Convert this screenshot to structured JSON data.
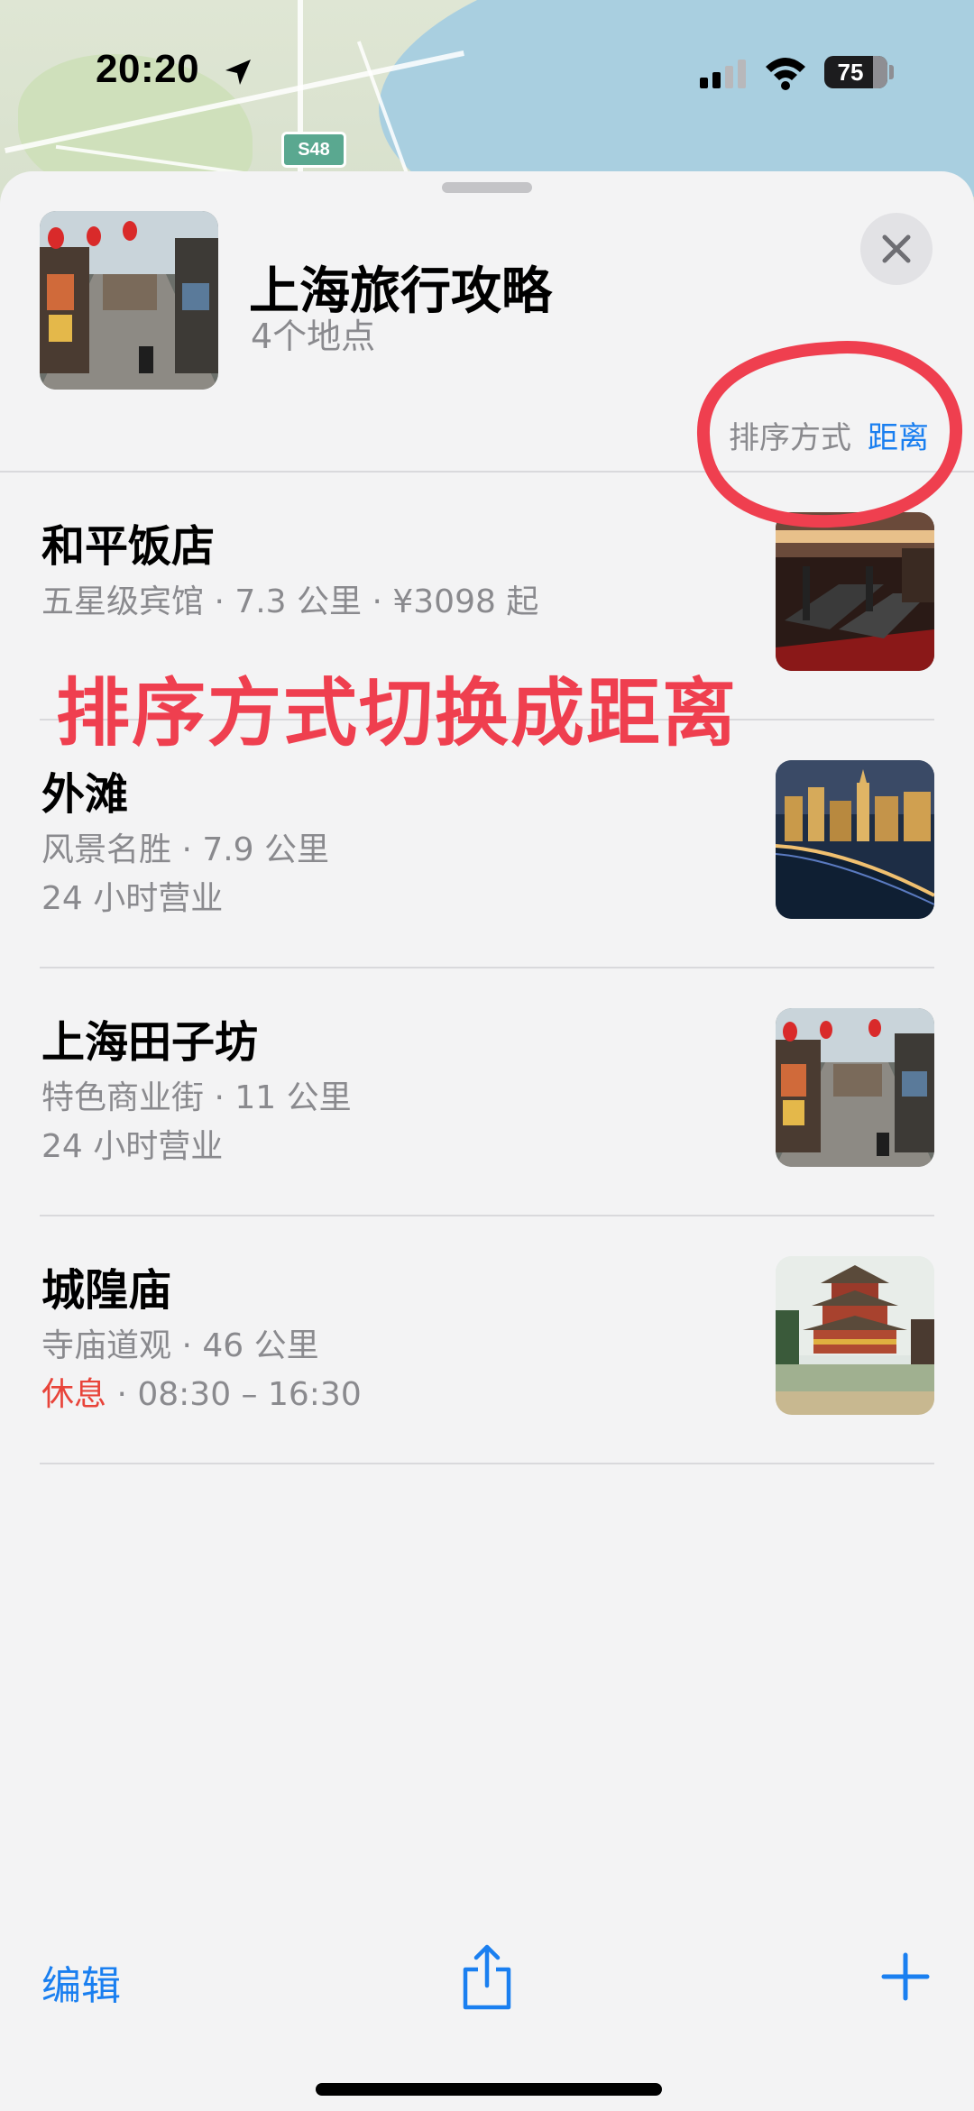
{
  "status_bar": {
    "time": "20:20",
    "battery": "75"
  },
  "map": {
    "road_shield": "S48"
  },
  "sheet": {
    "title": "上海旅行攻略",
    "subtitle": "4个地点",
    "sort_label": "排序方式",
    "sort_value": "距离"
  },
  "places": [
    {
      "name": "和平饭店",
      "meta": "五星级宾馆 · 7.3 公里 · ¥3098 起",
      "extra": "",
      "status": "",
      "hours": ""
    },
    {
      "name": "外滩",
      "meta": "风景名胜 · 7.9 公里",
      "extra": "24 小时营业",
      "status": "",
      "hours": ""
    },
    {
      "name": "上海田子坊",
      "meta": "特色商业街 · 11 公里",
      "extra": "24 小时营业",
      "status": "",
      "hours": ""
    },
    {
      "name": "城隍庙",
      "meta": "寺庙道观 · 46 公里",
      "extra": "",
      "status": "休息",
      "hours": " · 08:30 – 16:30"
    }
  ],
  "annotation": {
    "text": "排序方式切换成距离"
  },
  "toolbar": {
    "edit_label": "编辑"
  },
  "colors": {
    "accent": "#1a7ff0",
    "closed": "#e8443a",
    "annotation": "#ef3f4f"
  }
}
